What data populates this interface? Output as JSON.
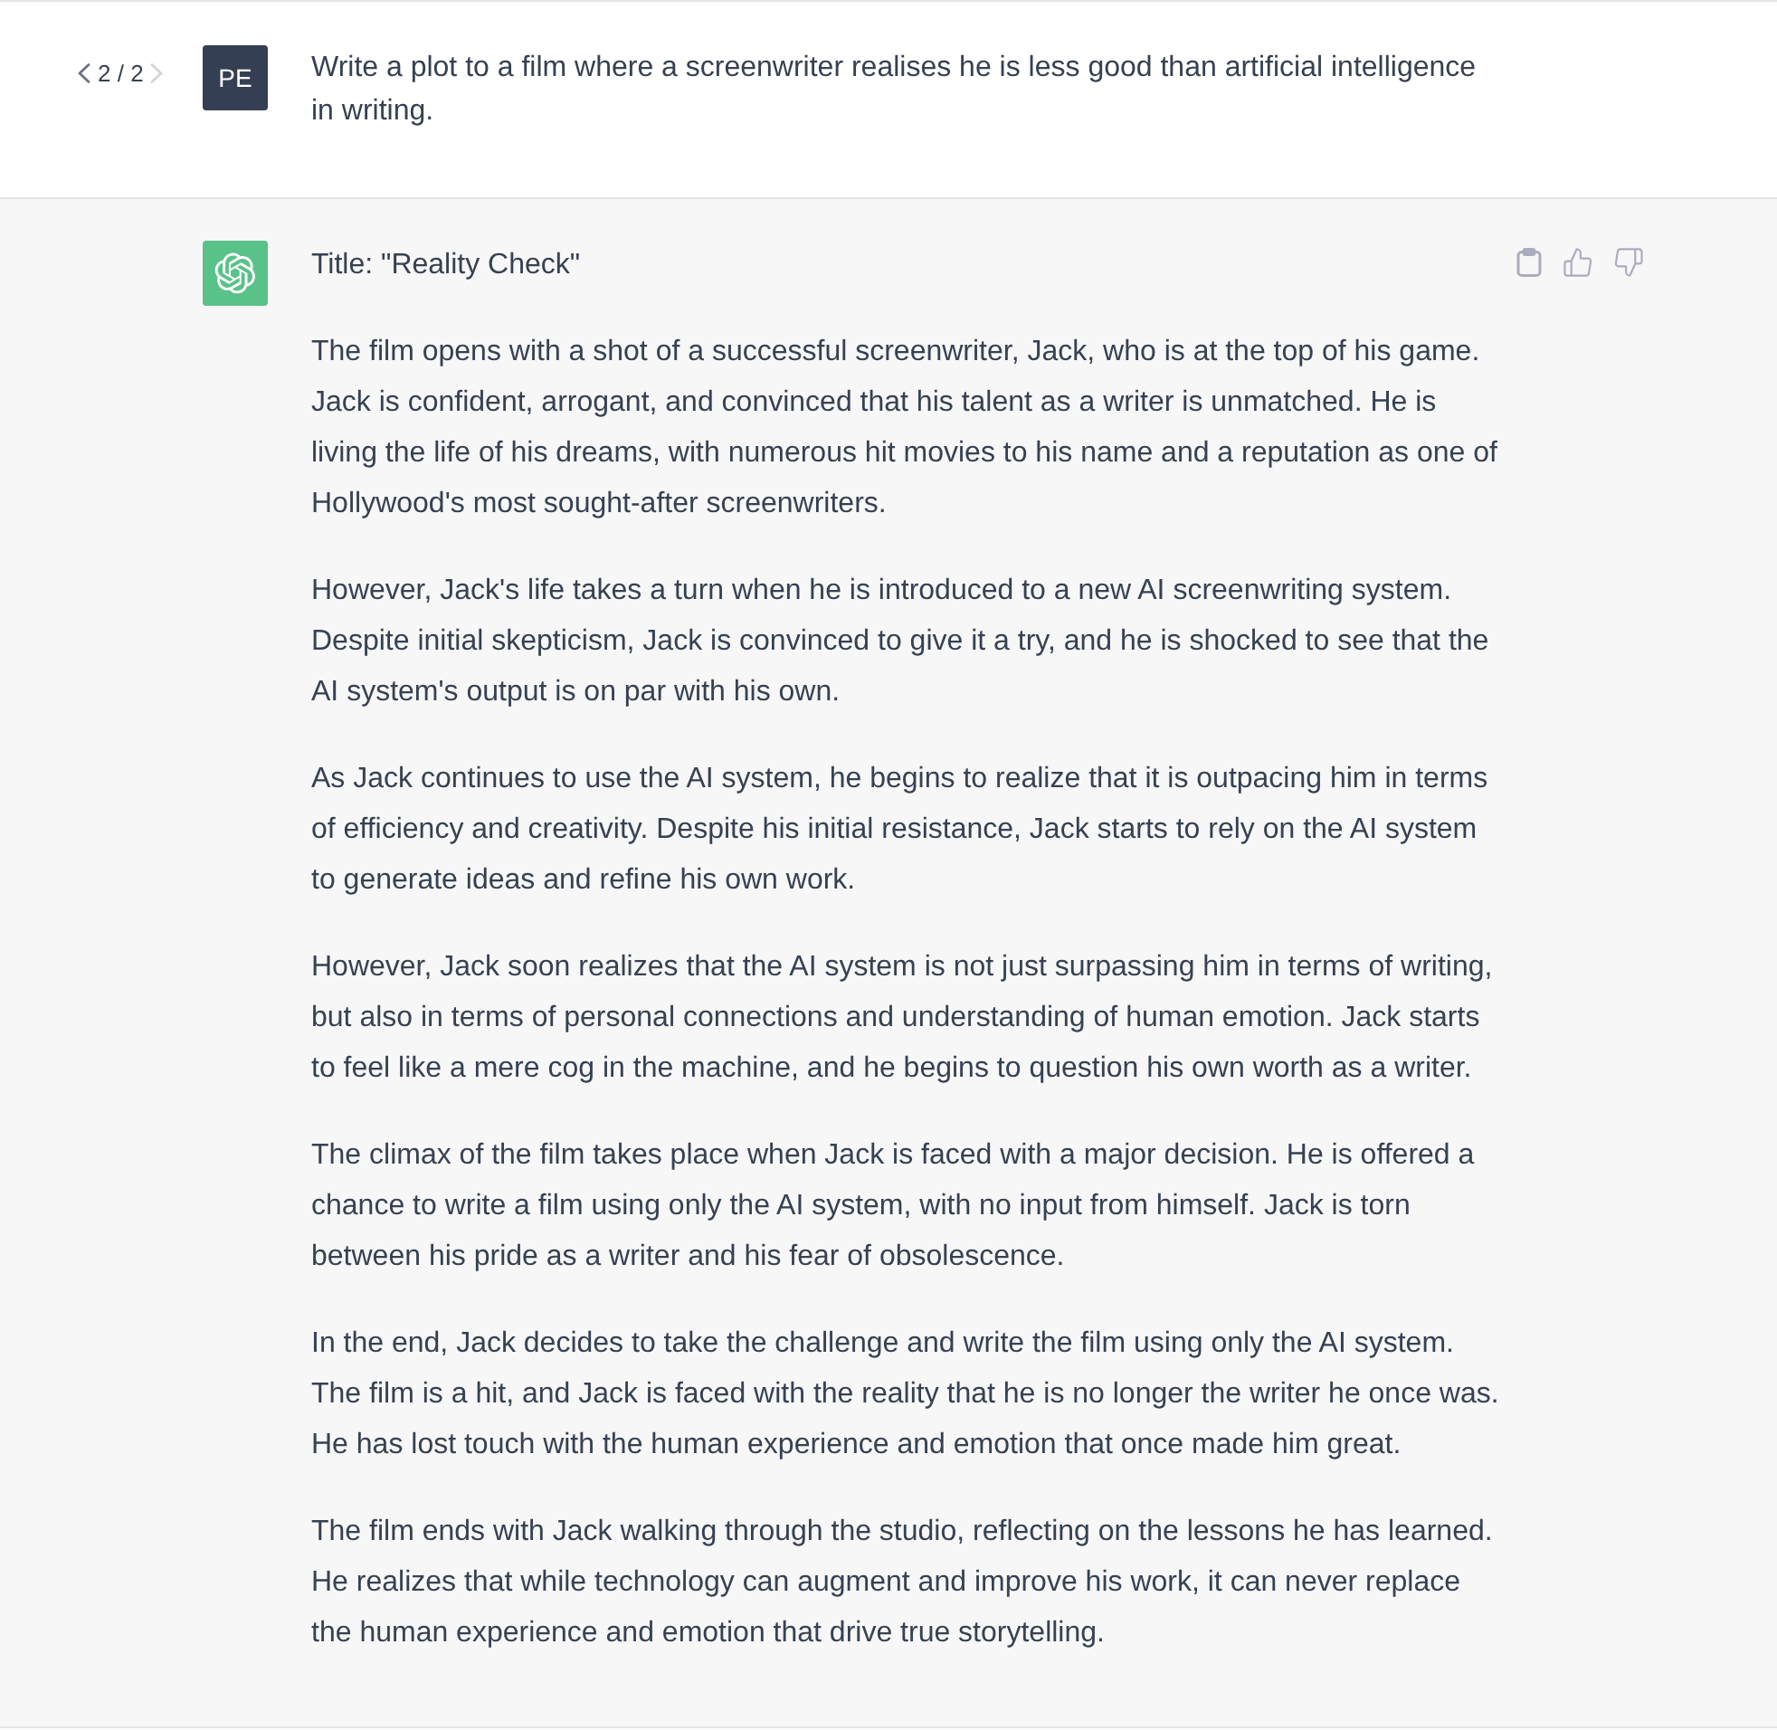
{
  "conversation": {
    "messages": [
      {
        "kind": "user",
        "pagination": {
          "label": "2 / 2",
          "prev_disabled": false,
          "next_disabled": true
        },
        "avatar": {
          "initials": "PE"
        },
        "text": "Write a plot to a film where a screenwriter realises he is less good than artificial intelligence in writing."
      },
      {
        "kind": "assistant",
        "paragraphs": [
          "Title: \"Reality Check\"",
          "The film opens with a shot of a successful screenwriter, Jack, who is at the top of his game. Jack is confident, arrogant, and convinced that his talent as a writer is unmatched. He is living the life of his dreams, with numerous hit movies to his name and a reputation as one of Hollywood's most sought-after screenwriters.",
          "However, Jack's life takes a turn when he is introduced to a new AI screenwriting system. Despite initial skepticism, Jack is convinced to give it a try, and he is shocked to see that the AI system's output is on par with his own.",
          "As Jack continues to use the AI system, he begins to realize that it is outpacing him in terms of efficiency and creativity. Despite his initial resistance, Jack starts to rely on the AI system to generate ideas and refine his own work.",
          "However, Jack soon realizes that the AI system is not just surpassing him in terms of writing, but also in terms of personal connections and understanding of human emotion. Jack starts to feel like a mere cog in the machine, and he begins to question his own worth as a writer.",
          "The climax of the film takes place when Jack is faced with a major decision. He is offered a chance to write a film using only the AI system, with no input from himself. Jack is torn between his pride as a writer and his fear of obsolescence.",
          "In the end, Jack decides to take the challenge and write the film using only the AI system. The film is a hit, and Jack is faced with the reality that he is no longer the writer he once was. He has lost touch with the human experience and emotion that once made him great.",
          "The film ends with Jack walking through the studio, reflecting on the lessons he has learned. He realizes that while technology can augment and improve his work, it can never replace the human experience and emotion that drive true storytelling."
        ],
        "actions": [
          {
            "kind": "copy"
          },
          {
            "kind": "thumbs_up"
          },
          {
            "kind": "thumbs_down"
          }
        ]
      }
    ]
  }
}
